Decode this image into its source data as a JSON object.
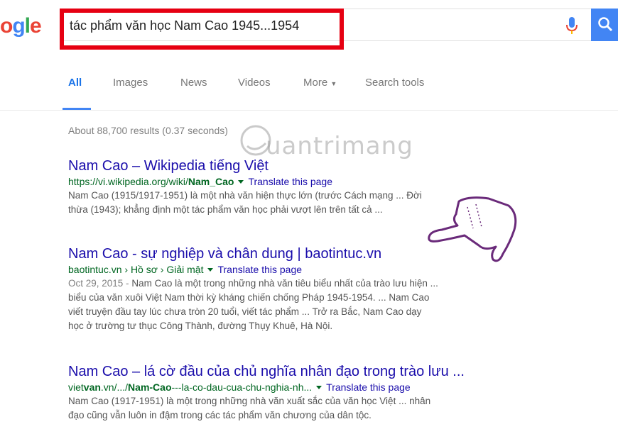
{
  "logo": {
    "part1": "o",
    "part2": "g",
    "part3": "l",
    "part4": "e"
  },
  "search": {
    "query": "tác phẩm văn học Nam Cao 1945...1954"
  },
  "tabs": [
    {
      "label": "All",
      "active": true
    },
    {
      "label": "Images"
    },
    {
      "label": "News"
    },
    {
      "label": "Videos"
    },
    {
      "label": "More"
    },
    {
      "label": "Search tools"
    }
  ],
  "stats": "About 88,700 results (0.37 seconds)",
  "watermark": "uantrimang",
  "results": [
    {
      "title": "Nam Cao – Wikipedia tiếng Việt",
      "url_pre": "https://vi.wikipedia.org/wiki/",
      "url_bold": "Nam_Cao",
      "translate": "Translate this page",
      "snippet_line1": "Nam Cao (1915/1917-1951) là một nhà văn hiện thực lớn (trước Cách mạng ... Đời",
      "snippet_line2": "thừa (1943); khẳng định một tác phẩm văn học phải vượt lên trên tất cả ..."
    },
    {
      "title": "Nam Cao - sự nghiệp và chân dung | baotintuc.vn",
      "url_pre": "baotintuc.vn › Hồ sơ › Giải mật",
      "translate": "Translate this page",
      "date": "Oct 29, 2015 -",
      "snippet_line1": "Nam Cao là một trong những nhà văn tiêu biểu nhất của trào lưu hiện ...",
      "snippet_line2": "biểu của văn xuôi Việt Nam thời kỳ kháng chiến chống Pháp 1945-1954. ... Nam Cao",
      "snippet_line3": "viết truyện đầu tay lúc chưa tròn 20 tuổi, viết tác phẩm ... Trở ra Bắc, Nam Cao dạy",
      "snippet_line4": "học ở trường tư thục Công Thành, đường Thụy Khuê, Hà Nội."
    },
    {
      "title": "Nam Cao – lá cờ đầu của chủ nghĩa nhân đạo trong trào lưu ...",
      "url_pre": "viet",
      "url_bold": "van",
      "url_mid": ".vn/.../",
      "url_bold2": "Nam-Cao",
      "url_post": "---la-co-dau-cua-chu-nghia-nh...",
      "translate": "Translate this page",
      "snippet_line1": "Nam Cao (1917-1951) là một trong những nhà văn xuất sắc của văn học Việt ... nhân",
      "snippet_line2": "đạo cũng vẫn luôn in đậm trong các tác phẩm văn chương của dân tộc."
    }
  ],
  "colors": {
    "link": "#1a0dab",
    "url": "#006621",
    "accent": "#4285f4",
    "highlight": "#e60012"
  },
  "icons": [
    "mic-icon",
    "search-icon",
    "pointing-hand-icon"
  ]
}
